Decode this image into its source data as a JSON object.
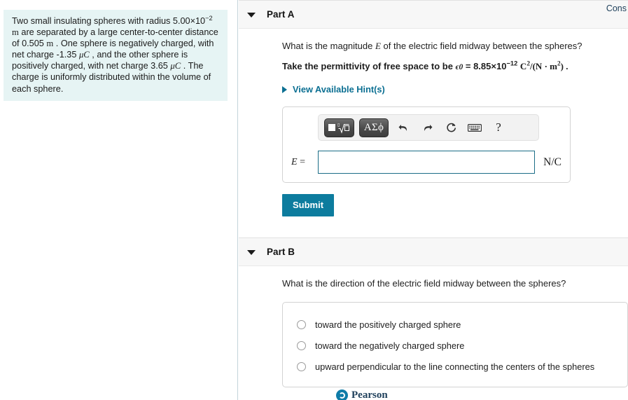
{
  "problem": {
    "line_prefix": "Two small insulating spheres with radius 5.00×10",
    "radius_exponent": "−2",
    "unit_m1": "m",
    "sentence_2": " are separated by a large center-to-center distance of 0.505 ",
    "unit_m2": "m",
    "sentence_3": " . One sphere is negatively charged, with net charge -1.35 ",
    "unit_uc1": "μC",
    "sentence_4": " , and the other sphere is positively charged, with net charge 3.65 ",
    "unit_uc2": "μC",
    "sentence_5": " . The charge is uniformly distributed within the volume of each sphere."
  },
  "topbar": {
    "label": "Cons"
  },
  "part_a": {
    "title": "Part A",
    "question_pre": "What is the magnitude ",
    "question_var": "E",
    "question_post": " of the electric field midway between the spheres?",
    "permittivity_pre": "Take the permittivity of free space to be ",
    "permittivity_symbol": "ϵ0",
    "permittivity_value": " = 8.85×10",
    "permittivity_exp": "−12",
    "permittivity_units_c": "C",
    "permittivity_units_c_exp": "2",
    "permittivity_units_rest": "/(N · m",
    "permittivity_units_m_exp": "2",
    "permittivity_units_close": ") .",
    "hint_label": "View Available Hint(s)",
    "toolbar": {
      "sqrt_button": "n-th-root",
      "greek_button": "ΑΣϕ",
      "undo": "undo-arrow",
      "redo": "redo-arrow",
      "reset": "reset-circular-arrow",
      "keyboard": "keyboard",
      "help": "?"
    },
    "answer_label": "E =",
    "answer_value": "",
    "answer_placeholder": "",
    "answer_unit": "N/C",
    "submit_label": "Submit"
  },
  "part_b": {
    "title": "Part B",
    "question": "What is the direction of the electric field midway between the spheres?",
    "options": [
      {
        "label": "toward the positively charged sphere",
        "selected": false
      },
      {
        "label": "toward the negatively charged sphere",
        "selected": false
      },
      {
        "label": "upward perpendicular to the line connecting the centers of the spheres",
        "selected": false
      }
    ]
  },
  "footer": {
    "brand": "Pearson"
  },
  "colors": {
    "problem_bg": "#e6f4f4",
    "accent_teal": "#0d7c9e",
    "link_teal": "#0b6f92",
    "input_border": "#1b6d87",
    "header_bg": "#f7f7f7",
    "divider": "#c3d3da"
  }
}
